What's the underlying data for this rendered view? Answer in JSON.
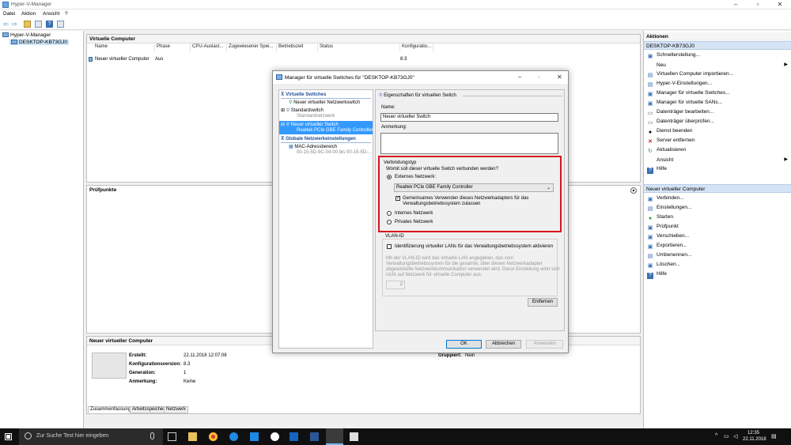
{
  "window": {
    "title": "Hyper-V-Manager"
  },
  "menu": [
    "Datei",
    "Aktion",
    "Ansicht",
    "?"
  ],
  "tree": {
    "root": "Hyper-V-Manager",
    "host": "DESKTOP-KB73GJ0"
  },
  "vm_pane": {
    "title": "Virtuelle Computer",
    "columns": [
      "Name",
      "Phase",
      "CPU-Auslast...",
      "Zugewiesener Spei...",
      "Betriebszeit",
      "Status",
      "Konfiguratio..."
    ],
    "rows": [
      {
        "name": "Neuer virtueller Computer",
        "phase": "Aus",
        "config": "8.3"
      }
    ]
  },
  "checkpoints_pane": {
    "title": "Prüfpunkte"
  },
  "details_pane": {
    "title": "Neuer virtueller Computer",
    "labels": {
      "created": "Erstellt:",
      "config_version": "Konfigurationsversion:",
      "generation": "Generation:",
      "note": "Anmerkung:",
      "grouped": "Gruppiert:"
    },
    "values": {
      "created": "22.11.2018 12:07:08",
      "config_version": "8.3",
      "generation": "1",
      "note": "Keine",
      "grouped": "Nein"
    },
    "tabs": [
      "Zusammenfassung",
      "Arbeitsspeicher",
      "Netzwerk"
    ]
  },
  "actions": {
    "title": "Aktionen",
    "host_header": "DESKTOP-KB73GJ0",
    "host_items": [
      "Schnellerstellung...",
      "Neu",
      "Virtuellen Computer importieren...",
      "Hyper-V-Einstellungen...",
      "Manager für virtuelle Switches...",
      "Manager für virtuelle SANs...",
      "Datenträger bearbeiten...",
      "Datenträger überprüfen...",
      "Dienst beenden",
      "Server entfernen",
      "Aktualisieren",
      "Ansicht",
      "Hilfe"
    ],
    "vm_header": "Neuer virtueller Computer",
    "vm_items": [
      "Verbinden...",
      "Einstellungen...",
      "Starten",
      "Prüfpunkt",
      "Verschieben...",
      "Exportieren...",
      "Umbenennen...",
      "Löschen...",
      "Hilfe"
    ]
  },
  "dialog": {
    "title": "Manager für virtuelle Switches für \"DESKTOP-KB73GJ0\"",
    "list": {
      "section_switches": "Virtuelle Switches",
      "new_switch": "Neuer virtueller Netzwerkswitch",
      "default_switch": "Standardswitch",
      "default_switch_sub": "Standardnetzwerk",
      "selected_switch": "Neuer virtueller Switch",
      "selected_switch_sub": "Realtek PCIe GBE Family Controller",
      "section_global": "Globale Netzwerkeinstellungen",
      "mac_range": "MAC-Adressbereich",
      "mac_range_sub": "00-15-5D-9C-04-00 bis 00-15-5D-..."
    },
    "props": {
      "header": "Eigenschaften für virtuellen Switch",
      "name_label": "Name:",
      "name_value": "Neuer virtueller Switch",
      "note_label": "Anmerkung:",
      "conn_type": "Verbindungstyp",
      "question": "Womit soll dieser virtuelle Switch verbunden werden?",
      "external": "Externes Netzwerk:",
      "adapter": "Realtek PCIe GBE Family Controller",
      "share_line1": "Gemeinsames Verwenden dieses Netzwerkadapters für das",
      "share_line2": "Verwaltungsbetriebssystem zulassen",
      "internal": "Internes Netzwerk",
      "private": "Privates Netzwerk",
      "vlan_title": "VLAN-ID",
      "vlan_check": "Identifizierung virtueller LANs für das Verwaltungsbetriebssystem aktivieren",
      "vlan_help1": "Mit der VLAN-ID wird das virtuelle LAN angegeben, das vom",
      "vlan_help2": "Verwaltungsbetriebssystem für die gesamte, über diesen Netzwerkadapter",
      "vlan_help3": "abgewickelte Netzwerkkommunikation verwendet wird. Diese Einstellung wirkt sich",
      "vlan_help4": "nicht auf Netzwerk für virtuelle Computer aus.",
      "vlan_value": "2",
      "remove_btn": "Entfernen"
    },
    "buttons": {
      "ok": "OK",
      "cancel": "Abbrechen",
      "apply": "Anwenden"
    }
  },
  "taskbar": {
    "search_placeholder": "Zur Suche Text hier eingeben",
    "time": "12:35",
    "date": "22.11.2018"
  },
  "colors": {
    "highlight": "#3399ff",
    "red_frame": "#d7151d",
    "section_blue": "#1f4f99"
  }
}
